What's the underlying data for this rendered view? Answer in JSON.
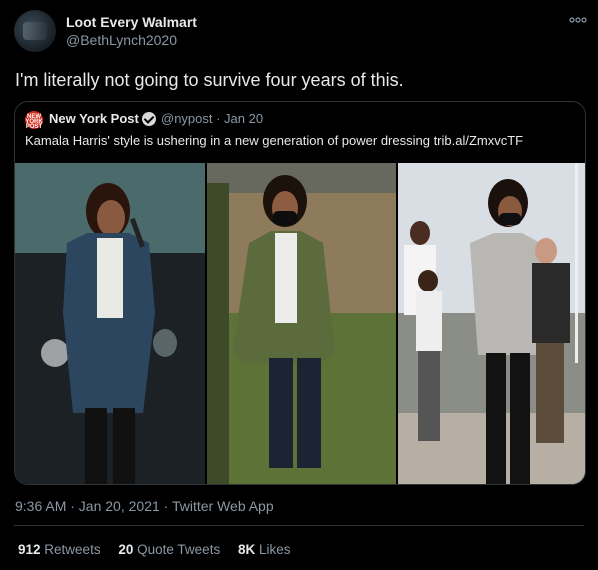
{
  "tweet": {
    "display_name": "Loot Every Walmart",
    "handle": "@BethLynch2020",
    "text": "I'm literally not going to survive four years of this.",
    "timestamp": "9:36 AM · Jan 20, 2021 · Twitter Web App"
  },
  "quote": {
    "name": "New York Post",
    "logo_text": "NEW YORK POST",
    "verified": true,
    "meta": "@nypost · Jan 20",
    "text": "Kamala Harris' style is ushering in a new generation of power dressing trib.al/ZmxvcTF"
  },
  "stats": {
    "retweets_count": "912",
    "retweets_label": "Retweets",
    "quotes_count": "20",
    "quotes_label": "Quote Tweets",
    "likes_count": "8K",
    "likes_label": "Likes"
  },
  "icons": {
    "more": "more-horizontal-icon",
    "verified": "verified-badge-icon"
  },
  "colors": {
    "background": "#000000",
    "text_primary": "#e7e9ea",
    "text_secondary": "#8b98a5",
    "border": "#2f3336",
    "nypost_red": "#d52b1e"
  }
}
